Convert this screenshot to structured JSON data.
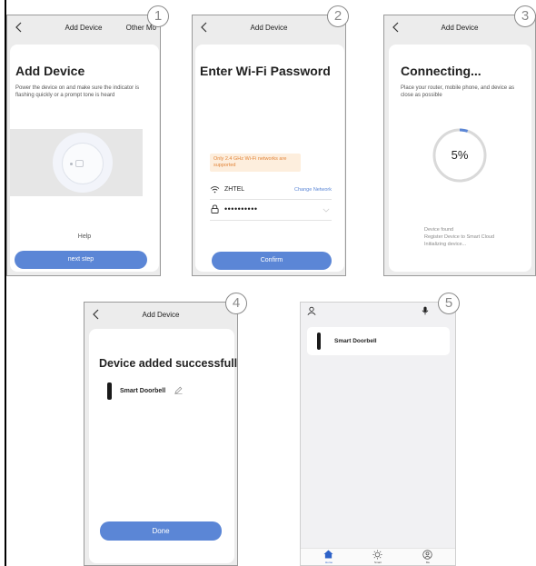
{
  "screens": [
    {
      "number": "1",
      "header_title": "Add Device",
      "header_action": "Other Mo",
      "heading": "Add Device",
      "description": "Power the device on and make sure the indicator is flashing quickly or a prompt tone is heard",
      "help_label": "Help",
      "button_label": "next step"
    },
    {
      "number": "2",
      "header_title": "Add Device",
      "heading": "Enter Wi-Fi Password",
      "notice": "Only 2.4 GHz Wi-Fi networks are supported",
      "network_name": "ZHTEL",
      "change_network_label": "Change Network",
      "password_value": "••••••••••",
      "button_label": "Confirm"
    },
    {
      "number": "3",
      "header_title": "Add Device",
      "heading": "Connecting...",
      "description": "Place your router, mobile phone, and device as close as possible",
      "progress_percent": 5,
      "progress_label": "5%",
      "steps": [
        "Device found",
        "Register Device to Smart Cloud",
        "Initializing device..."
      ]
    },
    {
      "number": "4",
      "header_title": "Add Device",
      "heading": "Device added successfully",
      "device_name": "Smart Doorbell",
      "button_label": "Done"
    },
    {
      "number": "5",
      "device_name": "Smart Doorbell",
      "nav": [
        "Home",
        "Smart",
        "Me"
      ]
    }
  ],
  "colors": {
    "accent": "#5b86d6",
    "phone_background": "#ececec",
    "notice_background": "#fdeedd",
    "notice_text": "#e2853a",
    "progress_track": "#d9d9d9"
  }
}
